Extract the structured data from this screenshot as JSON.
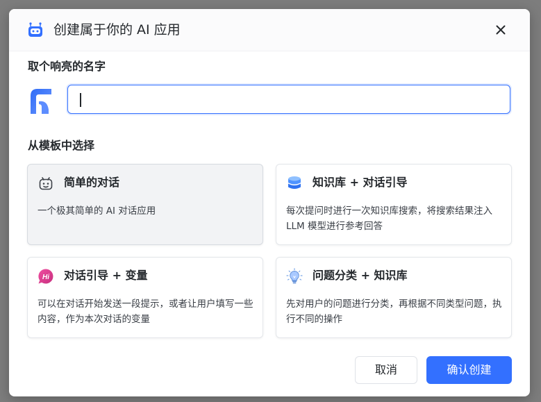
{
  "dialog": {
    "title": "创建属于你的 AI 应用",
    "header_icon": "robot-icon",
    "close_icon": "close-icon"
  },
  "name_section": {
    "label": "取个响亮的名字",
    "avatar_icon": "app-logo-icon",
    "input_value": "",
    "input_placeholder": ""
  },
  "template_section": {
    "label": "从模板中选择",
    "templates": [
      {
        "title": "简单的对话",
        "description": "一个极其简单的 AI 对话应用",
        "icon": "robot-face-icon",
        "selected": true
      },
      {
        "title": "知识库 + 对话引导",
        "description": "每次提问时进行一次知识库搜索，将搜索结果注入 LLM 模型进行参考回答",
        "icon": "database-icon",
        "selected": false
      },
      {
        "title": "对话引导 + 变量",
        "description": "可以在对话开始发送一段提示，或者让用户填写一些内容，作为本次对话的变量",
        "icon": "hi-badge-icon",
        "selected": false
      },
      {
        "title": "问题分类 + 知识库",
        "description": "先对用户的问题进行分类，再根据不同类型问题，执行不同的操作",
        "icon": "lightbulb-icon",
        "selected": false
      }
    ]
  },
  "footer": {
    "cancel_label": "取消",
    "confirm_label": "确认创建"
  },
  "colors": {
    "primary": "#3370ff",
    "selected_card_bg": "#f2f3f5",
    "overlay": "#7d7d7d"
  }
}
